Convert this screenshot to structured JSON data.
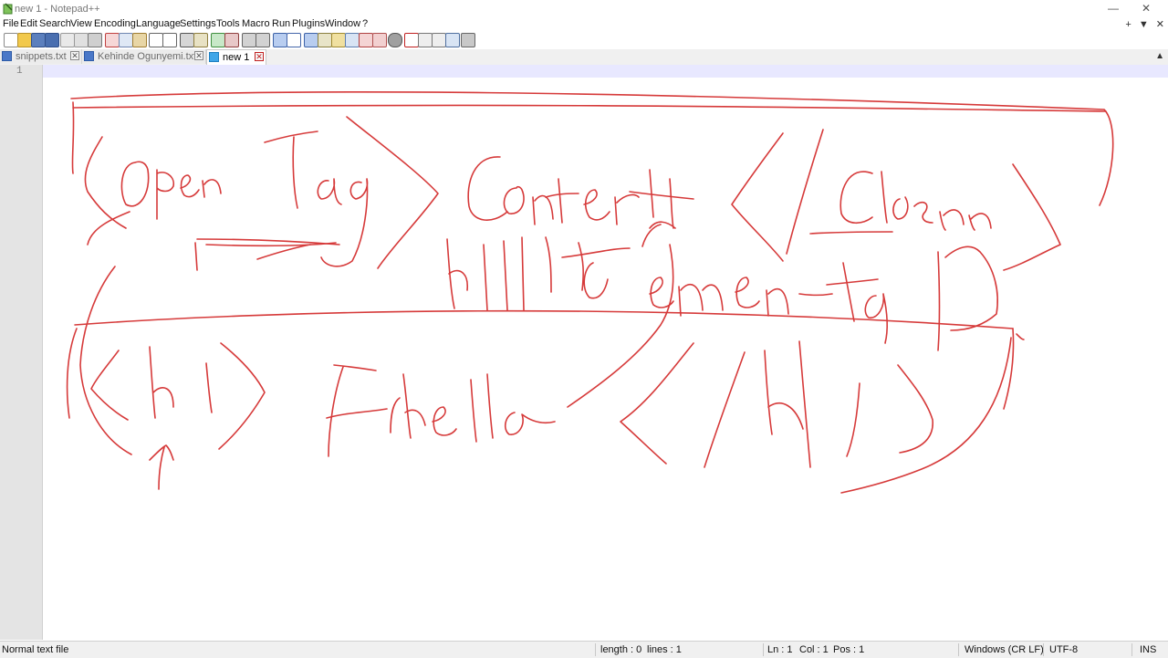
{
  "window": {
    "title": "new 1 - Notepad++",
    "minimize_glyph": "—",
    "restore_glyph": "❐",
    "close_glyph": "✕"
  },
  "menubar": {
    "items": [
      "File",
      "Edit",
      "Search",
      "View",
      "Encoding",
      "Language",
      "Settings",
      "Tools",
      "Macro",
      "Run",
      "Plugins",
      "Window",
      "?"
    ],
    "right_controls": [
      "+",
      "▼",
      "✕"
    ]
  },
  "toolbar": {
    "buttons": [
      "new-file-icon",
      "open-file-icon",
      "save-icon",
      "save-all-icon",
      "close-icon",
      "close-all-icon",
      "print-icon",
      "cut-icon",
      "copy-icon",
      "paste-icon",
      "undo-icon",
      "redo-icon",
      "find-icon",
      "replace-icon",
      "zoom-in-icon",
      "zoom-out-icon",
      "sync-vertical-icon",
      "sync-horizontal-icon",
      "word-wrap-icon",
      "show-all-characters-icon",
      "indent-guide-icon",
      "user-defined-language-icon",
      "document-map-icon",
      "function-list-icon",
      "folder-as-workspace-icon",
      "monitoring-icon",
      "record-macro-icon",
      "stop-recording-icon",
      "playback-macro-icon",
      "run-macro-multiple-icon",
      "save-macro-icon"
    ]
  },
  "tabs": [
    {
      "label": "snippets.txt",
      "active": false
    },
    {
      "label": "Kehinde Ogunyemi.txt",
      "active": false
    },
    {
      "label": "new 1",
      "active": true
    }
  ],
  "editor": {
    "line_numbers": [
      "1"
    ],
    "content": ""
  },
  "statusbar": {
    "file_type": "Normal text file",
    "length": "length : 0",
    "lines": "lines : 1",
    "ln": "Ln : 1",
    "col": "Col : 1",
    "pos": "Pos : 1",
    "eol": "Windows (CR LF)",
    "encoding": "UTF-8",
    "insert_mode": "INS"
  },
  "colors": {
    "ink": "#d63a3a",
    "gutter": "#e4e4e4",
    "current_line": "#e8e8ff"
  }
}
